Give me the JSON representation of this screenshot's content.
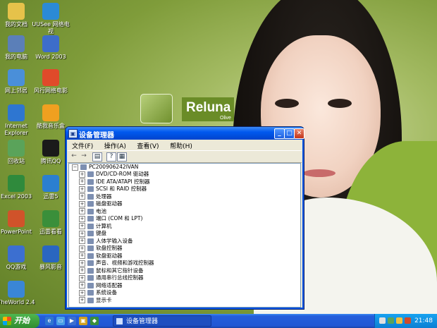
{
  "wallpaper": {
    "logo_text": "Reluna",
    "logo_sub": "Olive"
  },
  "desktop_icons": [
    {
      "label": "我的文档",
      "icon": "folder-icon",
      "color": "#e6c24a"
    },
    {
      "label": "UUSee 网络电视",
      "icon": "uusee-icon",
      "color": "#2b8ad6"
    },
    {
      "label": "我的电脑",
      "icon": "computer-icon",
      "color": "#5b7fb8"
    },
    {
      "label": "Word 2003",
      "icon": "word-icon",
      "color": "#3d6dc9"
    },
    {
      "label": "网上邻居",
      "icon": "network-icon",
      "color": "#4a8fd9"
    },
    {
      "label": "风行网络电影",
      "icon": "funshion-icon",
      "color": "#e04a2a"
    },
    {
      "label": "Internet Explorer",
      "icon": "ie-icon",
      "color": "#2e76d1"
    },
    {
      "label": "酷我音乐盒",
      "icon": "kuwo-icon",
      "color": "#f0a020"
    },
    {
      "label": "回收站",
      "icon": "recycle-bin-icon",
      "color": "#5aa35a"
    },
    {
      "label": "腾讯QQ",
      "icon": "qq-icon",
      "color": "#1a1a1a"
    },
    {
      "label": "Excel 2003",
      "icon": "excel-icon",
      "color": "#2f8a3c"
    },
    {
      "label": "迅雷5",
      "icon": "thunder-icon",
      "color": "#2b7fd0"
    },
    {
      "label": "PowerPoint",
      "icon": "powerpoint-icon",
      "color": "#d0532a"
    },
    {
      "label": "迅雷看看",
      "icon": "xunlei-kankan-icon",
      "color": "#3a8f3a"
    },
    {
      "label": "QQ游戏",
      "icon": "qq-game-icon",
      "color": "#3c6fd0"
    },
    {
      "label": "暴风影音",
      "icon": "baofeng-icon",
      "color": "#2a66c0"
    },
    {
      "label": "TheWorld 2.4",
      "icon": "theworld-icon",
      "color": "#3a86d6"
    }
  ],
  "window": {
    "title": "设备管理器",
    "menu": [
      "文件(F)",
      "操作(A)",
      "查看(V)",
      "帮助(H)"
    ],
    "root": "PC200906242IVAN",
    "items": [
      "DVD/CD-ROM 驱动器",
      "IDE ATA/ATAPI 控制器",
      "SCSI 和 RAID 控制器",
      "处理器",
      "磁盘驱动器",
      "电池",
      "端口 (COM 和 LPT)",
      "计算机",
      "键盘",
      "人体学输入设备",
      "软盘控制器",
      "软盘驱动器",
      "声音、视频和游戏控制器",
      "鼠标和其它指针设备",
      "通用串行总线控制器",
      "网络适配器",
      "系统设备",
      "显示卡"
    ]
  },
  "taskbar": {
    "start_label": "开始",
    "task_label": "设备管理器",
    "clock": "21:48"
  }
}
